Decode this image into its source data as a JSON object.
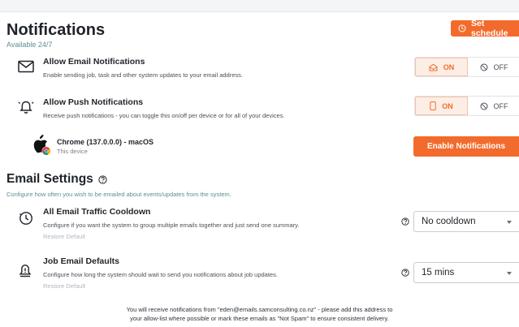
{
  "header": {
    "title": "Notifications",
    "subtitle": "Available 24/7",
    "schedule_button": "Set schedule"
  },
  "email_notifications": {
    "title": "Allow Email Notifications",
    "description": "Enable sending job, task and other system updates to your email address.",
    "on_label": "ON",
    "off_label": "OFF",
    "selected": "on"
  },
  "push_notifications": {
    "title": "Allow Push Notifications",
    "description": "Receive push notifications - you can toggle this on/off per device or for all of your devices.",
    "on_label": "ON",
    "off_label": "OFF",
    "selected": "on"
  },
  "device": {
    "name": "Chrome (137.0.0.0) - macOS",
    "note": "This device",
    "enable_button": "Enable Notifications"
  },
  "email_settings": {
    "title": "Email Settings",
    "subtitle": "Configure how often you wish to be emailed about events/updates from the system.",
    "rows": [
      {
        "title": "All Email Traffic Cooldown",
        "description": "Configure if you want the system to group multiple emails together and just send one summary.",
        "restore": "Restore Default",
        "value": "No cooldown"
      },
      {
        "title": "Job Email Defaults",
        "description": "Configure how long the system should wait to send you notifications about job updates.",
        "restore": "Restore Default",
        "value": "15 mins"
      }
    ]
  },
  "footer": {
    "line1": "You will receive notifications from \"eden@emails.samconsulting.co.nz\" - please add this address to",
    "line2": "your allow-list where possible or mark these emails as \"Not Spam\" to ensure consistent delivery."
  },
  "colors": {
    "accent": "#f26b2c",
    "accent_light": "#fdeee5",
    "subtitle_teal": "#5d8f92"
  }
}
